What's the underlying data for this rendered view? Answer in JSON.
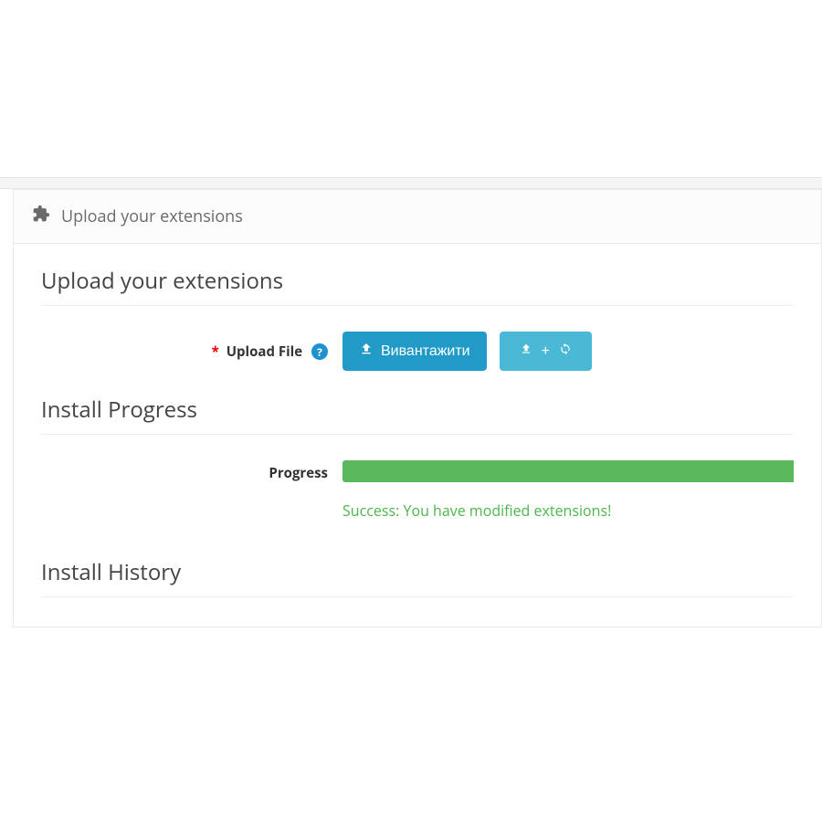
{
  "panel": {
    "header_title": "Upload your extensions"
  },
  "upload": {
    "section_title": "Upload your extensions",
    "label": "Upload File",
    "button_label": "Вивантажити"
  },
  "progress": {
    "section_title": "Install Progress",
    "label": "Progress",
    "success_message": "Success: You have modified extensions!"
  },
  "history": {
    "section_title": "Install History"
  }
}
